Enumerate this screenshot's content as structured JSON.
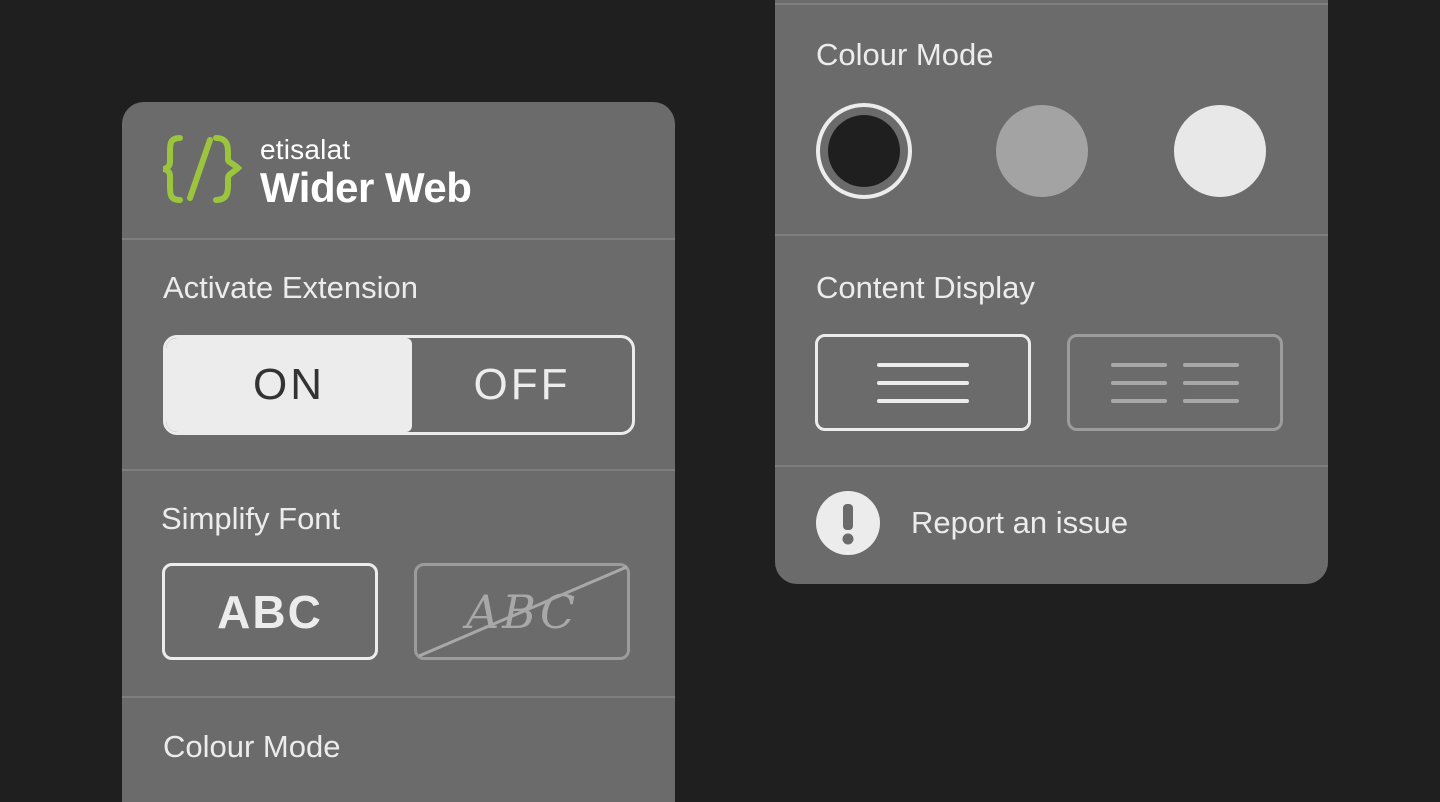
{
  "brand": {
    "sub": "etisalat",
    "main": "Wider Web",
    "accent_color": "#9bc53d"
  },
  "left_panel": {
    "activate": {
      "label": "Activate Extension",
      "on_label": "ON",
      "off_label": "OFF",
      "selected": "ON"
    },
    "font": {
      "label": "Simplify Font",
      "simple_label": "ABC",
      "default_label": "ABC",
      "selected": "simple"
    },
    "colour_mode_label": "Colour Mode"
  },
  "right_panel": {
    "colour_mode": {
      "label": "Colour Mode",
      "options": [
        "dark",
        "grey",
        "light"
      ],
      "selected": "dark",
      "colors": {
        "dark": "#1f1f1f",
        "grey": "#a3a3a3",
        "light": "#e8e8e8"
      }
    },
    "content_display": {
      "label": "Content Display",
      "options": [
        "single-column",
        "two-column"
      ],
      "selected": "single-column"
    },
    "report": {
      "label": "Report an issue",
      "icon": "exclamation-icon"
    }
  }
}
